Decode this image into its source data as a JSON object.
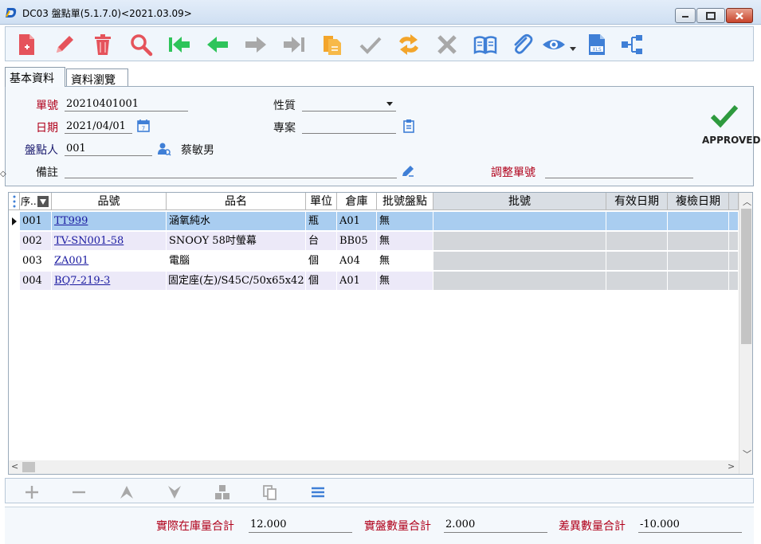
{
  "window": {
    "title": "DC03 盤點單(5.1.7.0)<2021.03.09>"
  },
  "toolbar": {
    "icons": [
      "new-doc-icon",
      "edit-pencil-icon",
      "delete-trash-icon",
      "search-magnifier-icon",
      "first-record-icon",
      "prev-record-icon",
      "next-record-icon",
      "last-record-icon",
      "copy-doc-icon",
      "confirm-check-icon",
      "refresh-exchange-icon",
      "cancel-x-icon",
      "book-icon",
      "attachment-clip-icon",
      "view-eye-icon",
      "excel-export-icon",
      "flowchart-icon"
    ]
  },
  "tabs": [
    {
      "label": "基本資料",
      "active": true
    },
    {
      "label": "資料瀏覽",
      "active": false
    }
  ],
  "form": {
    "doc_no_label": "單號",
    "doc_no": "20210401001",
    "date_label": "日期",
    "date": "2021/04/01",
    "counter_label": "盤點人",
    "counter_id": "001",
    "counter_name": "蔡敏男",
    "note_label": "備註",
    "note": "",
    "nature_label": "性質",
    "nature": "",
    "project_label": "專案",
    "project": "",
    "adjust_label": "調整單號",
    "adjust_no": "",
    "status": "APPROVED",
    "status_color": "#2e9a3e"
  },
  "grid": {
    "headers": {
      "seq": "序...",
      "part_no": "品號",
      "part_name": "品名",
      "unit": "單位",
      "warehouse": "倉庫",
      "batch_count": "批號盤點",
      "batch_no": "批號",
      "expiry": "有效日期",
      "recheck": "複檢日期"
    },
    "rows": [
      {
        "seq": "001",
        "part_no": "TT999",
        "part_name": "涵氧純水",
        "unit": "瓶",
        "warehouse": "A01",
        "batch_count": "無"
      },
      {
        "seq": "002",
        "part_no": "TV-SN001-58",
        "part_name": "SNOOY 58吋螢幕",
        "unit": "台",
        "warehouse": "BB05",
        "batch_count": "無"
      },
      {
        "seq": "003",
        "part_no": "ZA001",
        "part_name": "電腦",
        "unit": "個",
        "warehouse": "A04",
        "batch_count": "無"
      },
      {
        "seq": "004",
        "part_no": "BQ7-219-3",
        "part_name": "固定座(左)/S45C/50x65x42",
        "unit": "個",
        "warehouse": "A01",
        "batch_count": "無"
      }
    ]
  },
  "totals": {
    "actual_stock_label": "實際在庫量合計",
    "actual_stock": "12.000",
    "counted_label": "實盤數量合計",
    "counted": "2.000",
    "diff_label": "差異數量合計",
    "diff": "-10.000"
  }
}
